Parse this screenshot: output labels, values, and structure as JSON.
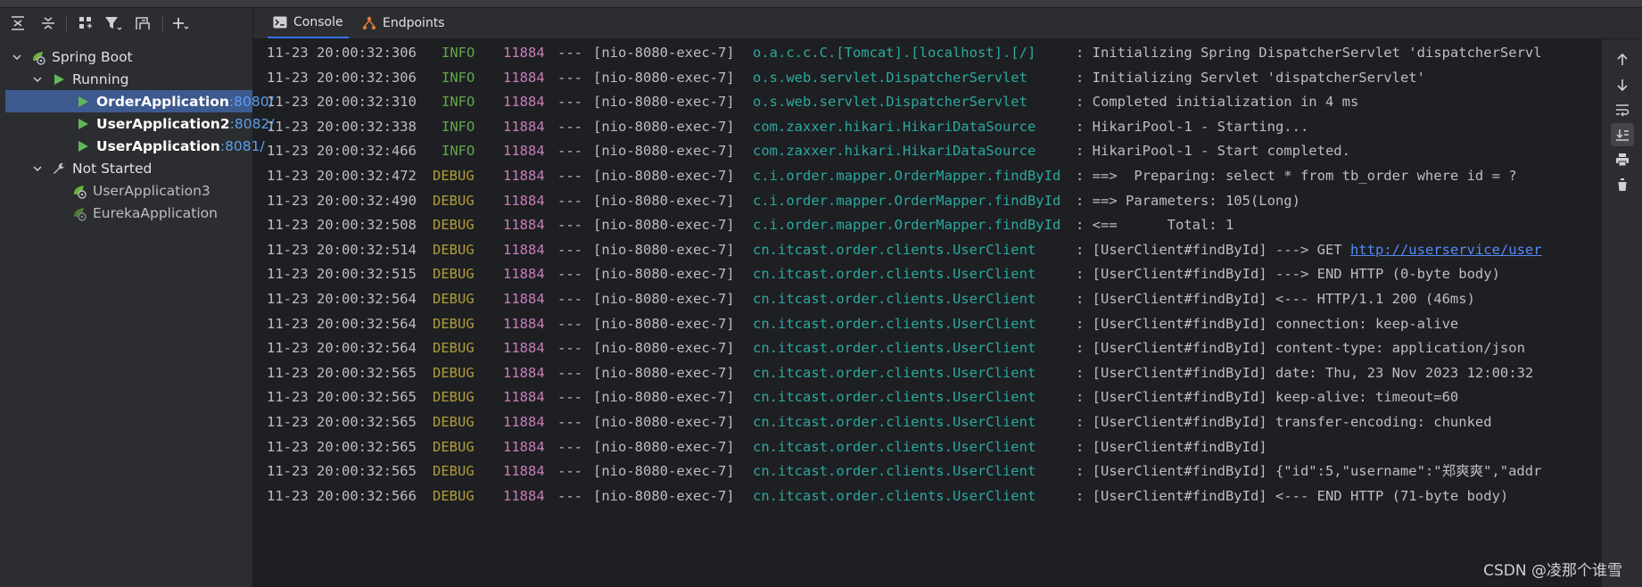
{
  "colors": {
    "panel": "#2b2d30",
    "console_bg": "#1e1f22",
    "selected_row": "#3d5a8f",
    "info": "#62a64c",
    "debug": "#b09d3a",
    "pid": "#c77dbb",
    "logger": "#2aaaa0",
    "link": "#548af7",
    "port": "#5c9ded"
  },
  "tabs": [
    {
      "label": "Console",
      "icon": "console-icon",
      "active": true
    },
    {
      "label": "Endpoints",
      "icon": "endpoints-icon",
      "active": false
    }
  ],
  "tree": {
    "root": {
      "label": "Spring Boot",
      "icon": "spring-boot-icon"
    },
    "running": {
      "label": "Running",
      "icon": "run-icon"
    },
    "running_apps": [
      {
        "name": "OrderApplication",
        "port": ":8080/",
        "selected": true
      },
      {
        "name": "UserApplication2",
        "port": ":8082/",
        "selected": false
      },
      {
        "name": "UserApplication",
        "port": ":8081/",
        "selected": false
      }
    ],
    "not_started": {
      "label": "Not Started",
      "icon": "wrench-icon"
    },
    "not_started_apps": [
      {
        "name": "UserApplication3"
      },
      {
        "name": "EurekaApplication"
      }
    ]
  },
  "toolbar_icons": [
    "expand-all-icon",
    "collapse-all-icon",
    "group-by-icon",
    "filter-icon",
    "new-group-icon",
    "add-icon"
  ],
  "right_toolbar_icons": [
    "scroll-up-icon",
    "scroll-down-icon",
    "soft-wrap-icon",
    "scroll-to-end-icon",
    "print-icon",
    "clear-all-icon"
  ],
  "log": [
    {
      "ts": "11-23 20:00:32:306",
      "level": "INFO",
      "pid": "11884",
      "sep": "---",
      "thread": "[nio-8080-exec-7]",
      "logger": "o.a.c.c.C.[Tomcat].[localhost].[/]",
      "msg": ": Initializing Spring DispatcherServlet 'dispatcherServl"
    },
    {
      "ts": "11-23 20:00:32:306",
      "level": "INFO",
      "pid": "11884",
      "sep": "---",
      "thread": "[nio-8080-exec-7]",
      "logger": "o.s.web.servlet.DispatcherServlet",
      "msg": ": Initializing Servlet 'dispatcherServlet'"
    },
    {
      "ts": "11-23 20:00:32:310",
      "level": "INFO",
      "pid": "11884",
      "sep": "---",
      "thread": "[nio-8080-exec-7]",
      "logger": "o.s.web.servlet.DispatcherServlet",
      "msg": ": Completed initialization in 4 ms"
    },
    {
      "ts": "11-23 20:00:32:338",
      "level": "INFO",
      "pid": "11884",
      "sep": "---",
      "thread": "[nio-8080-exec-7]",
      "logger": "com.zaxxer.hikari.HikariDataSource",
      "msg": ": HikariPool-1 - Starting..."
    },
    {
      "ts": "11-23 20:00:32:466",
      "level": "INFO",
      "pid": "11884",
      "sep": "---",
      "thread": "[nio-8080-exec-7]",
      "logger": "com.zaxxer.hikari.HikariDataSource",
      "msg": ": HikariPool-1 - Start completed."
    },
    {
      "ts": "11-23 20:00:32:472",
      "level": "DEBUG",
      "pid": "11884",
      "sep": "---",
      "thread": "[nio-8080-exec-7]",
      "logger": "c.i.order.mapper.OrderMapper.findById",
      "msg": ": ==>  Preparing: select * from tb_order where id = ?"
    },
    {
      "ts": "11-23 20:00:32:490",
      "level": "DEBUG",
      "pid": "11884",
      "sep": "---",
      "thread": "[nio-8080-exec-7]",
      "logger": "c.i.order.mapper.OrderMapper.findById",
      "msg": ": ==> Parameters: 105(Long)"
    },
    {
      "ts": "11-23 20:00:32:508",
      "level": "DEBUG",
      "pid": "11884",
      "sep": "---",
      "thread": "[nio-8080-exec-7]",
      "logger": "c.i.order.mapper.OrderMapper.findById",
      "msg": ": <==      Total: 1"
    },
    {
      "ts": "11-23 20:00:32:514",
      "level": "DEBUG",
      "pid": "11884",
      "sep": "---",
      "thread": "[nio-8080-exec-7]",
      "logger": "cn.itcast.order.clients.UserClient",
      "msg": ": [UserClient#findById] ---> GET ",
      "link": "http://userservice/user"
    },
    {
      "ts": "11-23 20:00:32:515",
      "level": "DEBUG",
      "pid": "11884",
      "sep": "---",
      "thread": "[nio-8080-exec-7]",
      "logger": "cn.itcast.order.clients.UserClient",
      "msg": ": [UserClient#findById] ---> END HTTP (0-byte body)"
    },
    {
      "ts": "11-23 20:00:32:564",
      "level": "DEBUG",
      "pid": "11884",
      "sep": "---",
      "thread": "[nio-8080-exec-7]",
      "logger": "cn.itcast.order.clients.UserClient",
      "msg": ": [UserClient#findById] <--- HTTP/1.1 200 (46ms)"
    },
    {
      "ts": "11-23 20:00:32:564",
      "level": "DEBUG",
      "pid": "11884",
      "sep": "---",
      "thread": "[nio-8080-exec-7]",
      "logger": "cn.itcast.order.clients.UserClient",
      "msg": ": [UserClient#findById] connection: keep-alive"
    },
    {
      "ts": "11-23 20:00:32:564",
      "level": "DEBUG",
      "pid": "11884",
      "sep": "---",
      "thread": "[nio-8080-exec-7]",
      "logger": "cn.itcast.order.clients.UserClient",
      "msg": ": [UserClient#findById] content-type: application/json"
    },
    {
      "ts": "11-23 20:00:32:565",
      "level": "DEBUG",
      "pid": "11884",
      "sep": "---",
      "thread": "[nio-8080-exec-7]",
      "logger": "cn.itcast.order.clients.UserClient",
      "msg": ": [UserClient#findById] date: Thu, 23 Nov 2023 12:00:32"
    },
    {
      "ts": "11-23 20:00:32:565",
      "level": "DEBUG",
      "pid": "11884",
      "sep": "---",
      "thread": "[nio-8080-exec-7]",
      "logger": "cn.itcast.order.clients.UserClient",
      "msg": ": [UserClient#findById] keep-alive: timeout=60"
    },
    {
      "ts": "11-23 20:00:32:565",
      "level": "DEBUG",
      "pid": "11884",
      "sep": "---",
      "thread": "[nio-8080-exec-7]",
      "logger": "cn.itcast.order.clients.UserClient",
      "msg": ": [UserClient#findById] transfer-encoding: chunked"
    },
    {
      "ts": "11-23 20:00:32:565",
      "level": "DEBUG",
      "pid": "11884",
      "sep": "---",
      "thread": "[nio-8080-exec-7]",
      "logger": "cn.itcast.order.clients.UserClient",
      "msg": ": [UserClient#findById]"
    },
    {
      "ts": "11-23 20:00:32:565",
      "level": "DEBUG",
      "pid": "11884",
      "sep": "---",
      "thread": "[nio-8080-exec-7]",
      "logger": "cn.itcast.order.clients.UserClient",
      "msg": ": [UserClient#findById] {\"id\":5,\"username\":\"郑爽爽\",\"addr"
    },
    {
      "ts": "11-23 20:00:32:566",
      "level": "DEBUG",
      "pid": "11884",
      "sep": "---",
      "thread": "[nio-8080-exec-7]",
      "logger": "cn.itcast.order.clients.UserClient",
      "msg": ": [UserClient#findById] <--- END HTTP (71-byte body)"
    }
  ],
  "watermark": "CSDN @凌那个谁雪"
}
